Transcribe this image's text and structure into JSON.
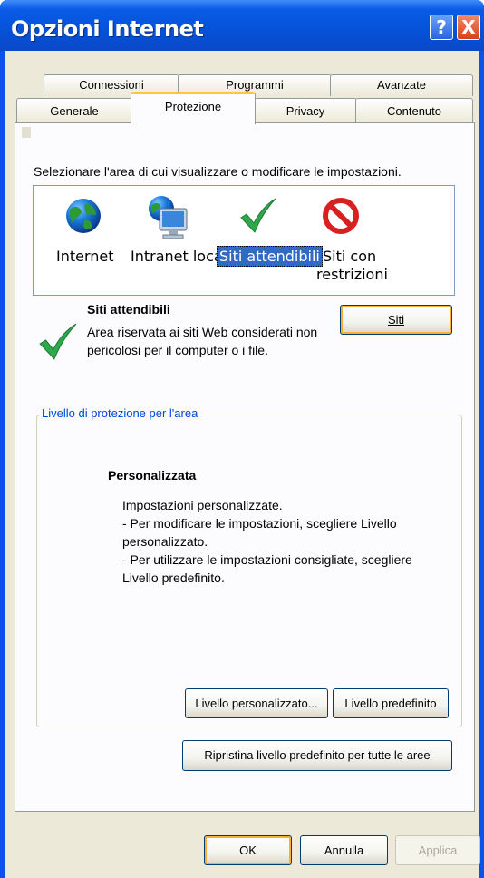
{
  "window": {
    "title": "Opzioni Internet",
    "help": "?",
    "close": "X"
  },
  "tabs_row1": [
    "Connessioni",
    "Programmi",
    "Avanzate"
  ],
  "tabs_row2": [
    "Generale",
    "Protezione",
    "Privacy",
    "Contenuto"
  ],
  "active_tab": "Protezione",
  "protection": {
    "prompt": "Selezionare l'area di cui visualizzare o modificare le impostazioni.",
    "zones": [
      {
        "label": "Internet",
        "icon": "globe-icon"
      },
      {
        "label": "Intranet locale",
        "icon": "intranet-icon"
      },
      {
        "label": "Siti attendibili",
        "icon": "checkmark-icon",
        "selected": true
      },
      {
        "label_line1": "Siti con",
        "label_line2": "restrizioni",
        "icon": "restricted-icon"
      }
    ],
    "zone_title": "Siti attendibili",
    "zone_desc_line1": "Area riservata ai siti Web considerati non",
    "zone_desc_line2": "pericolosi per il computer o i file.",
    "sites_button": "Siti",
    "level_group_title": "Livello di protezione per l'area",
    "level_title": "Personalizzata",
    "level_lines": [
      "Impostazioni personalizzate.",
      "- Per modificare le impostazioni, scegliere Livello",
      "personalizzato.",
      "- Per utilizzare le impostazioni consigliate, scegliere",
      "Livello predefinito."
    ],
    "custom_level_button": "Livello personalizzato...",
    "default_level_button": "Livello predefinito",
    "reset_all_button": "Ripristina livello predefinito per tutte le aree"
  },
  "buttons": {
    "ok": "OK",
    "cancel": "Annulla",
    "apply": "Applica"
  },
  "colors": {
    "titlebar": "#0552d8",
    "selection": "#316ac5",
    "group_title": "#0046d5",
    "focus_tab": "#ffc83c"
  }
}
